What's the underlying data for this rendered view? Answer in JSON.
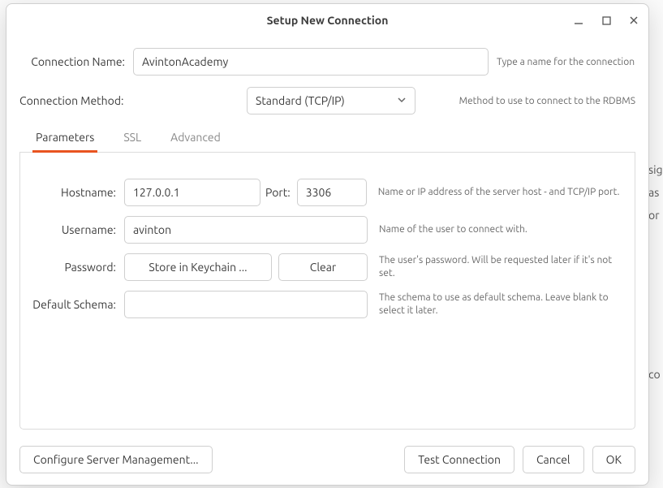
{
  "window": {
    "title": "Setup New Connection"
  },
  "top": {
    "conn_name_label": "Connection Name:",
    "conn_name_value": "AvintonAcademy",
    "conn_name_hint": "Type a name for the connection",
    "method_label": "Connection Method:",
    "method_value": "Standard (TCP/IP)",
    "method_hint": "Method to use to connect to the RDBMS"
  },
  "tabs": {
    "parameters": "Parameters",
    "ssl": "SSL",
    "advanced": "Advanced"
  },
  "params": {
    "hostname_label": "Hostname:",
    "hostname_value": "127.0.0.1",
    "port_label": "Port:",
    "port_value": "3306",
    "hostname_desc": "Name or IP address of the server host - and TCP/IP port.",
    "username_label": "Username:",
    "username_value": "avinton",
    "username_desc": "Name of the user to connect with.",
    "password_label": "Password:",
    "store_btn": "Store in Keychain ...",
    "clear_btn": "Clear",
    "password_desc": "The user's password. Will be requested later if it's not set.",
    "schema_label": "Default Schema:",
    "schema_value": "",
    "schema_desc": "The schema to use as default schema. Leave blank to select it later."
  },
  "footer": {
    "configure": "Configure Server Management...",
    "test": "Test Connection",
    "cancel": "Cancel",
    "ok": "OK"
  },
  "bg_hints": [
    "sig",
    "as",
    "or",
    "",
    "",
    "",
    "",
    "co"
  ]
}
